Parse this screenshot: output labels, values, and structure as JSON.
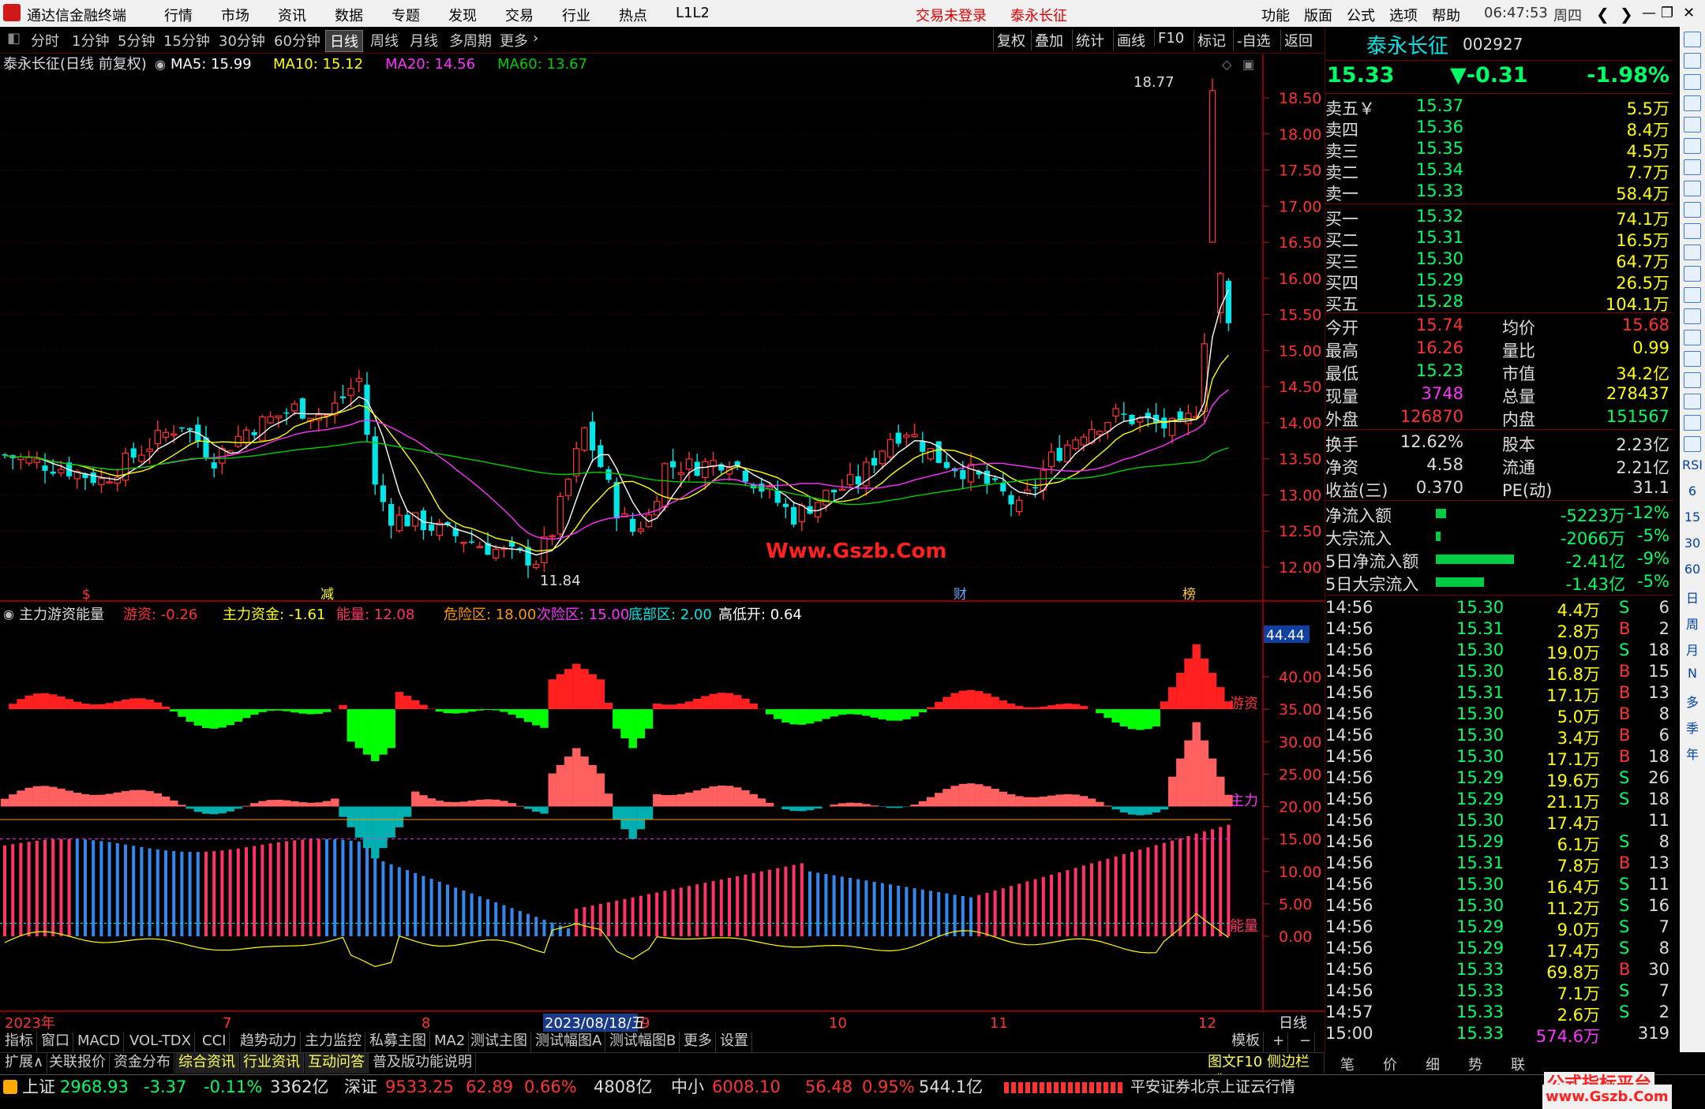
{
  "menubar": {
    "app_title": "通达信金融终端",
    "items": [
      "行情",
      "市场",
      "资讯",
      "数据",
      "专题",
      "发现",
      "交易",
      "行业",
      "热点",
      "L1L2"
    ],
    "login_status": "交易未登录",
    "stock_name": "泰永长征",
    "right_items": [
      "功能",
      "版面",
      "公式",
      "选项",
      "帮助"
    ],
    "time": "06:47:53",
    "weekday": "周四"
  },
  "periods": [
    "分时",
    "1分钟",
    "5分钟",
    "15分钟",
    "30分钟",
    "60分钟",
    "日线",
    "周线",
    "月线",
    "多周期",
    "更多"
  ],
  "selected_period": "日线",
  "toolbar_right": [
    "复权",
    "叠加",
    "统计",
    "画线",
    "F10",
    "标记",
    "-自选",
    "返回"
  ],
  "kline": {
    "title": "泰永长征(日线 前复权)",
    "ma5_label": "MA5: 15.99",
    "ma10_label": "MA10: 15.12",
    "ma20_label": "MA20: 14.56",
    "ma60_label": "MA60: 13.67",
    "high_label": "18.77",
    "low_label": "11.84",
    "watermark": "Www.Gszb.Com",
    "y_ticks": [
      "18.50",
      "18.00",
      "17.50",
      "17.00",
      "16.50",
      "16.00",
      "15.50",
      "15.00",
      "14.50",
      "14.00",
      "13.50",
      "13.00",
      "12.50",
      "12.00"
    ],
    "event_marks": [
      "$",
      "减",
      "财",
      "榜"
    ]
  },
  "indicator": {
    "title": "主力游资能量",
    "youzi_label": "游资: -0.26",
    "zhuli_label": "主力资金: -1.61",
    "nengliang_label": "能量: 12.08",
    "danger_label": "危险区: 18.00",
    "sub_danger_label": "次险区: 15.00",
    "bottom_label": "底部区: 2.00",
    "gaodikai_label": "高低开: 0.64",
    "current_value": "44.44",
    "y_ticks": [
      "40.00",
      "35.00",
      "30.00",
      "25.00",
      "20.00",
      "15.00",
      "10.00",
      "5.00",
      "0.00"
    ],
    "series_labels": [
      "游资",
      "主力",
      "能量"
    ]
  },
  "xaxis": {
    "labels": [
      "2023年",
      "7",
      "8",
      "9",
      "10",
      "11",
      "12"
    ],
    "cursor_date": "2023/08/18/五",
    "right_label": "日线"
  },
  "bottom_tabs": [
    "指标",
    "窗口",
    "MACD",
    "VOL-TDX",
    "CCI",
    "趋势动力",
    "主力监控",
    "私募主图",
    "MA2",
    "测试主图",
    "测试幅图A",
    "测试幅图B",
    "更多",
    "设置"
  ],
  "bottom_tabs_right": [
    "模板",
    "+",
    "−"
  ],
  "bottom_tabs2": [
    "扩展∧",
    "关联报价",
    "资金分布",
    "综合资讯",
    "行业资讯",
    "互动问答",
    "普及版功能说明"
  ],
  "bottom_tabs2_right": "图文F10 侧边栏《",
  "quote": {
    "name": "泰永长征",
    "code": "002927",
    "price": "15.33",
    "change": "▼-0.31",
    "change_pct": "-1.98%",
    "sells": [
      {
        "label": "卖五￥",
        "price": "15.37",
        "vol": "5.5万"
      },
      {
        "label": "卖四",
        "price": "15.36",
        "vol": "8.4万"
      },
      {
        "label": "卖三",
        "price": "15.35",
        "vol": "4.5万"
      },
      {
        "label": "卖二",
        "price": "15.34",
        "vol": "7.7万"
      },
      {
        "label": "卖一",
        "price": "15.33",
        "vol": "58.4万"
      }
    ],
    "buys": [
      {
        "label": "买一",
        "price": "15.32",
        "vol": "74.1万"
      },
      {
        "label": "买二",
        "price": "15.31",
        "vol": "16.5万"
      },
      {
        "label": "买三",
        "price": "15.30",
        "vol": "64.7万"
      },
      {
        "label": "买四",
        "price": "15.29",
        "vol": "26.5万"
      },
      {
        "label": "买五",
        "price": "15.28",
        "vol": "104.1万"
      }
    ],
    "stats1": [
      {
        "l1": "今开",
        "v1": "15.74",
        "l2": "均价",
        "v2": "15.68"
      },
      {
        "l1": "最高",
        "v1": "16.26",
        "l2": "量比",
        "v2": "0.99"
      },
      {
        "l1": "最低",
        "v1": "15.23",
        "l2": "市值",
        "v2": "34.2亿"
      },
      {
        "l1": "现量",
        "v1": "3748",
        "l2": "总量",
        "v2": "278437"
      },
      {
        "l1": "外盘",
        "v1": "126870",
        "l2": "内盘",
        "v2": "151567"
      }
    ],
    "stats2": [
      {
        "l1": "换手",
        "v1": "12.62%",
        "l2": "股本",
        "v2": "2.23亿"
      },
      {
        "l1": "净资",
        "v1": "4.58",
        "l2": "流通",
        "v2": "2.21亿"
      },
      {
        "l1": "收益(三)",
        "v1": "0.370",
        "l2": "PE(动)",
        "v2": "31.1"
      }
    ],
    "flows": [
      {
        "label": "净流入额",
        "val": "-5223万",
        "pct": "-12%",
        "bar": 0.12
      },
      {
        "label": "大宗流入",
        "val": "-2066万",
        "pct": "-5%",
        "bar": 0.05
      },
      {
        "label": "5日净流入额",
        "val": "-2.41亿",
        "pct": "-9%",
        "bar": 0.9
      },
      {
        "label": "5日大宗流入",
        "val": "-1.43亿",
        "pct": "-5%",
        "bar": 0.55
      }
    ],
    "ticks": [
      {
        "t": "14:56",
        "p": "15.30",
        "v": "4.4万",
        "d": "S",
        "n": "6"
      },
      {
        "t": "14:56",
        "p": "15.31",
        "v": "2.8万",
        "d": "B",
        "n": "2"
      },
      {
        "t": "14:56",
        "p": "15.30",
        "v": "19.0万",
        "d": "S",
        "n": "18"
      },
      {
        "t": "14:56",
        "p": "15.30",
        "v": "16.8万",
        "d": "B",
        "n": "15"
      },
      {
        "t": "14:56",
        "p": "15.31",
        "v": "17.1万",
        "d": "B",
        "n": "13"
      },
      {
        "t": "14:56",
        "p": "15.30",
        "v": "5.0万",
        "d": "B",
        "n": "8"
      },
      {
        "t": "14:56",
        "p": "15.30",
        "v": "3.4万",
        "d": "B",
        "n": "6"
      },
      {
        "t": "14:56",
        "p": "15.30",
        "v": "17.1万",
        "d": "B",
        "n": "18"
      },
      {
        "t": "14:56",
        "p": "15.29",
        "v": "19.6万",
        "d": "S",
        "n": "26"
      },
      {
        "t": "14:56",
        "p": "15.29",
        "v": "21.1万",
        "d": "S",
        "n": "18"
      },
      {
        "t": "14:56",
        "p": "15.30",
        "v": "17.4万",
        "d": "",
        "n": "11"
      },
      {
        "t": "14:56",
        "p": "15.29",
        "v": "6.1万",
        "d": "S",
        "n": "8"
      },
      {
        "t": "14:56",
        "p": "15.31",
        "v": "7.8万",
        "d": "B",
        "n": "13"
      },
      {
        "t": "14:56",
        "p": "15.30",
        "v": "16.4万",
        "d": "S",
        "n": "11"
      },
      {
        "t": "14:56",
        "p": "15.30",
        "v": "11.2万",
        "d": "S",
        "n": "16"
      },
      {
        "t": "14:56",
        "p": "15.29",
        "v": "9.0万",
        "d": "S",
        "n": "7"
      },
      {
        "t": "14:56",
        "p": "15.29",
        "v": "17.4万",
        "d": "S",
        "n": "8"
      },
      {
        "t": "14:56",
        "p": "15.33",
        "v": "69.8万",
        "d": "B",
        "n": "30"
      },
      {
        "t": "14:56",
        "p": "15.33",
        "v": "7.1万",
        "d": "S",
        "n": "7"
      },
      {
        "t": "14:57",
        "p": "15.33",
        "v": "2.6万",
        "d": "S",
        "n": "2"
      },
      {
        "t": "15:00",
        "p": "15.33",
        "v": "574.6万",
        "d": "",
        "n": "319"
      }
    ],
    "tabs": [
      "笔",
      "价",
      "细",
      "势",
      "联"
    ]
  },
  "sidebar": {
    "labels": [
      "RSI",
      "6",
      "15",
      "30",
      "60",
      "日",
      "周",
      "月",
      "N",
      "多",
      "季",
      "年"
    ]
  },
  "status": {
    "sh_name": "上证",
    "sh_val": "2968.93",
    "sh_chg": "-3.37",
    "sh_pct": "-0.11%",
    "sh_amt": "3362亿",
    "sz_name": "深证",
    "sz_val": "9533.25",
    "sz_chg": "62.89",
    "sz_pct": "0.66%",
    "sz_amt": "4808亿",
    "zx_name": "中小",
    "zx_val": "6008.10",
    "zx_chg": "56.48",
    "zx_pct": "0.95%",
    "zx_amt": "544.1亿",
    "broker": "平安证券北京上证云行情",
    "site_brand": "公式指标平台",
    "site_url": "www.Gszb.Com"
  },
  "colors": {
    "up": "#ff3333",
    "down": "#00e5e5",
    "ma5": "#ffffff",
    "ma10": "#ffff00",
    "ma20": "#ff33ff",
    "ma60": "#00cc00",
    "youzi_pos": "#ff2020",
    "youzi_neg": "#00ff00",
    "zhuli_pos": "#ff6060",
    "zhuli_neg": "#00b0b0",
    "energy_up": "#ff3366",
    "energy_down": "#3388ee"
  }
}
